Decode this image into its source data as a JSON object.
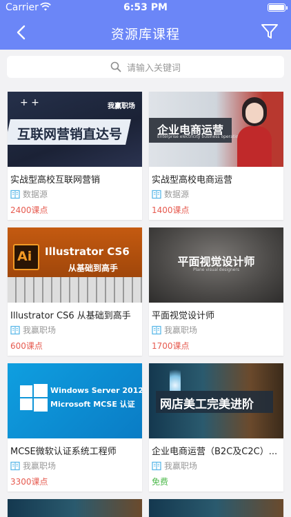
{
  "status_bar": {
    "carrier": "Carrier",
    "time": "6:53 PM"
  },
  "nav": {
    "title": "资源库课程",
    "back_icon": "chevron-left-icon",
    "filter_icon": "filter-icon"
  },
  "search": {
    "placeholder": "请输入关键词"
  },
  "cards": [
    {
      "thumb_text": "互联网营销直达号",
      "thumb_logo": "我赢职场",
      "title": "实战型高校互联网营销",
      "source": "数据源",
      "count": "2400课点"
    },
    {
      "thumb_text": "企业电商运营",
      "thumb_sub": "Enterprise electricity business operations",
      "title": "实战型高校电商运营",
      "source": "数据源",
      "count": "1400课点"
    },
    {
      "thumb_text": "Illustrator CS6",
      "thumb_sub": "从基础到高手",
      "thumb_logo": "Ai",
      "title": "Illustrator CS6 从基础到高手",
      "source": "我赢职场",
      "count": "600课点"
    },
    {
      "thumb_text": "平面视觉设计师",
      "thumb_sub": "Plane visual designers",
      "title": "平面视觉设计师",
      "source": "我赢职场",
      "count": "1700课点"
    },
    {
      "thumb_text": "Windows Server 2012",
      "thumb_sub": "Microsoft MCSE 认证",
      "title": "MCSE微软认证系统工程师",
      "source": "我赢职场",
      "count": "3300课点"
    },
    {
      "thumb_text": "网店美工完美进阶",
      "title": "企业电商运营（B2C及C2C）...",
      "source": "我赢职场",
      "count": "免费"
    }
  ],
  "colors": {
    "header": "#6b86f7",
    "count": "#e65a4f",
    "free": "#4cb84a",
    "source_icon": "#5bb8e8"
  }
}
